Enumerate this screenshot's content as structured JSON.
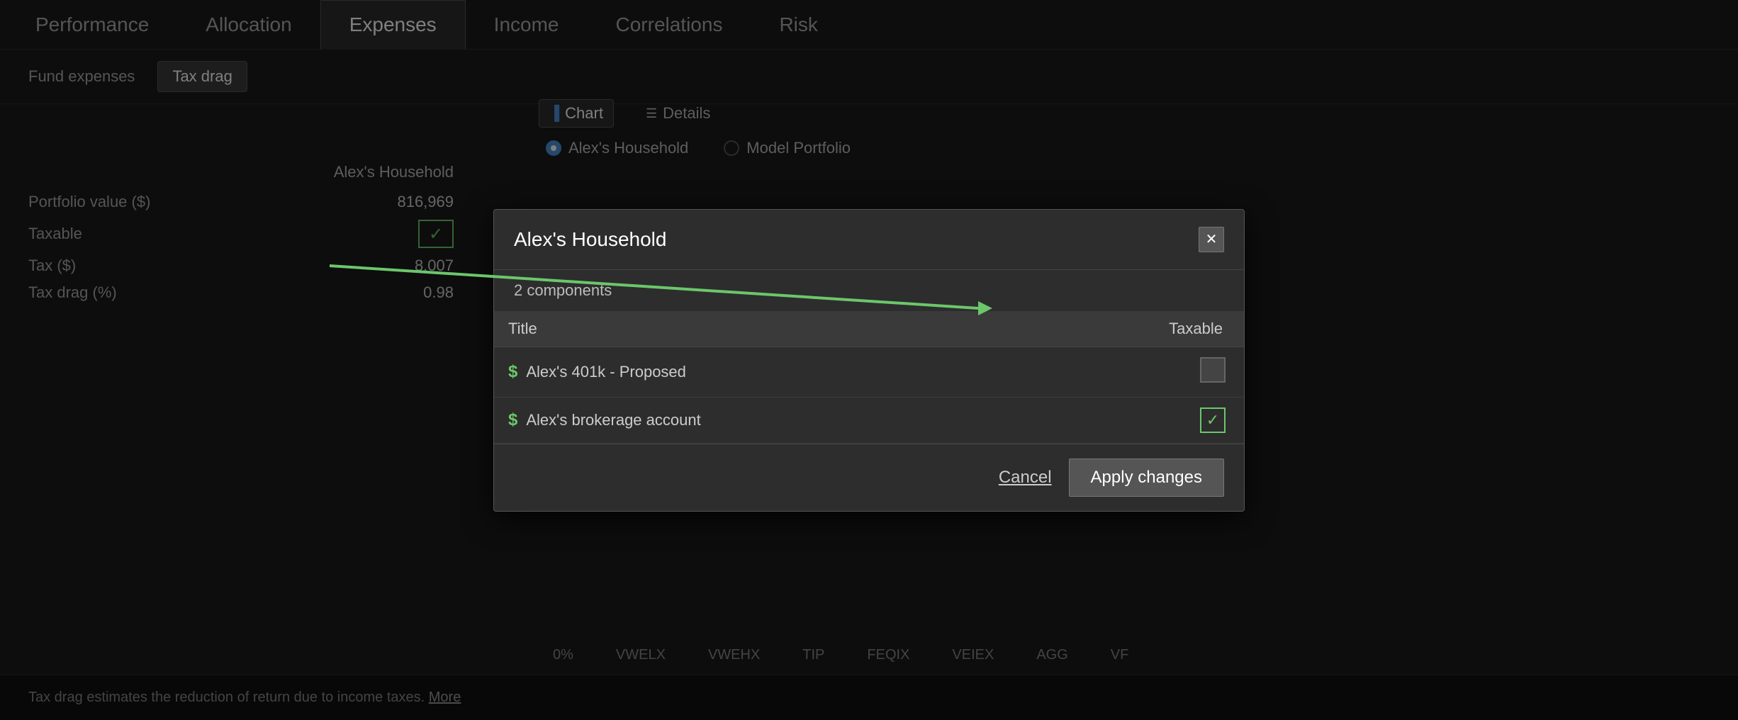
{
  "nav": {
    "tabs": [
      {
        "id": "performance",
        "label": "Performance",
        "active": false
      },
      {
        "id": "allocation",
        "label": "Allocation",
        "active": false
      },
      {
        "id": "expenses",
        "label": "Expenses",
        "active": true
      },
      {
        "id": "income",
        "label": "Income",
        "active": false
      },
      {
        "id": "correlations",
        "label": "Correlations",
        "active": false
      },
      {
        "id": "risk",
        "label": "Risk",
        "active": false
      }
    ]
  },
  "subtabs": [
    {
      "id": "fund-expenses",
      "label": "Fund expenses",
      "active": false
    },
    {
      "id": "tax-drag",
      "label": "Tax drag",
      "active": true
    }
  ],
  "viewToggle": {
    "chart": {
      "label": "Chart",
      "active": true
    },
    "details": {
      "label": "Details",
      "active": false
    }
  },
  "radioOptions": [
    {
      "id": "alexs-household",
      "label": "Alex's Household",
      "selected": true
    },
    {
      "id": "model-portfolio",
      "label": "Model Portfolio",
      "selected": false
    }
  ],
  "mainTable": {
    "header": "Alex's Household",
    "rows": [
      {
        "label": "Portfolio value ($)",
        "value": "816,969",
        "hasCheckbox": false
      },
      {
        "label": "Taxable",
        "value": "",
        "hasCheckbox": true,
        "checked": true
      },
      {
        "label": "Tax ($)",
        "value": "8,007",
        "hasCheckbox": false
      },
      {
        "label": "Tax drag (%)",
        "value": "0.98",
        "hasCheckbox": false
      }
    ]
  },
  "bottomBar": {
    "text": "Tax drag estimates the reduction of return due to income taxes.",
    "linkText": "More"
  },
  "bottomTicker": [
    "0%",
    "VWELX",
    "VWEHX",
    "TIP",
    "FEQIX",
    "VEIEX",
    "AGG",
    "VF"
  ],
  "modal": {
    "title": "Alex's Household",
    "subtitle": "2 components",
    "tableHeaders": {
      "title": "Title",
      "taxable": "Taxable"
    },
    "rows": [
      {
        "id": "alexs-401k",
        "icon": "$",
        "title": "Alex's 401k - Proposed",
        "taxable": false
      },
      {
        "id": "alexs-brokerage",
        "icon": "$",
        "title": "Alex's brokerage account",
        "taxable": true
      }
    ],
    "cancelLabel": "Cancel",
    "applyLabel": "Apply changes"
  }
}
